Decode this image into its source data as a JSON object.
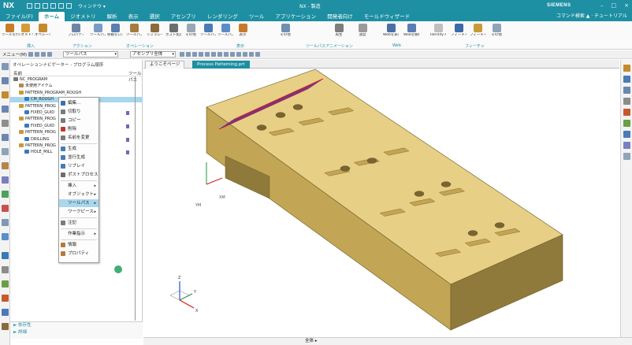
{
  "titlebar": {
    "logo": "NX",
    "window_menu": "ウィンドウ ▾",
    "document": "NX - 製造",
    "brand": "SIEMENS",
    "buttons": [
      "–",
      "□",
      "×"
    ]
  },
  "menubar": {
    "tabs": [
      "ファイル(F)",
      "ホーム",
      "ジオメトリ",
      "解析",
      "表示",
      "選択",
      "アセンブリ",
      "レンダリング",
      "ツール",
      "アプリケーション",
      "開発者向け",
      "モールドウィザード"
    ],
    "active_index": 1,
    "right_info": "コマンド検索    ▲ · チュートリアル"
  },
  "ribbon": {
    "buttons": [
      {
        "label": "ツールを作成",
        "color": "#c97c2a"
      },
      {
        "label": "ジオメトリを作成",
        "color": "#d59a3a"
      },
      {
        "label": "オペレーションを作成",
        "color": "#c48a2e"
      },
      {
        "label": "プロパティ",
        "color": "#6f85a8"
      },
      {
        "label": "ツールパス生成",
        "color": "#7a9cc4"
      },
      {
        "label": "移動をロック",
        "color": "#5a7fb0"
      },
      {
        "label": "ツールパスの検証",
        "color": "#a77a40"
      },
      {
        "label": "シミュレーション",
        "color": "#8a6b3c"
      },
      {
        "label": "ポスト処理",
        "color": "#6d6d6d"
      },
      {
        "label": "その他",
        "color": "#9aa6b5"
      },
      {
        "label": "ツールパスを表示",
        "color": "#4a7ab8"
      },
      {
        "label": "ツールパスを消去",
        "color": "#5c8cc6"
      },
      {
        "label": "表示",
        "color": "#c87a2c"
      },
      {
        "label": "その他",
        "color": "#6f8fb3"
      },
      {
        "label": "再生",
        "color": "#7d7d7d"
      },
      {
        "label": "速度",
        "color": "#9a9a9a"
      },
      {
        "label": "Webを表示",
        "color": "#4b6fa5"
      },
      {
        "label": "Webを解析",
        "color": "#5a7db3"
      },
      {
        "label": "Identify Features",
        "color": "#bfbfbf"
      },
      {
        "label": "フィーチャーを検出",
        "color": "#3b6aa8"
      },
      {
        "label": "フィーチャーグループ",
        "color": "#c99a3a"
      },
      {
        "label": "その他",
        "color": "#8fa3ba"
      }
    ],
    "groups": [
      "挿入",
      "アクション",
      "オペレーション",
      "表示",
      "ツールパスアニメーション",
      "Web",
      "フィーチャ"
    ]
  },
  "toolbar": {
    "menu_label": "メニュー(M) ▾",
    "filter_value": "ツールパス",
    "assembly_value": "アセンブリ全体"
  },
  "navigator": {
    "title": "オペレーションナビゲーター - プログラム順序",
    "col_name": "名前",
    "col_path": "ツールパス",
    "rows": [
      {
        "label": "NC_PROGRAM",
        "indent": 0,
        "icon": "#777777",
        "selected": false,
        "mark": false
      },
      {
        "label": "未使用アイテム",
        "indent": 1,
        "icon": "#b08a4a",
        "selected": false,
        "mark": false
      },
      {
        "label": "PATTERN_PROGRAM_ROUGH",
        "indent": 1,
        "icon": "#c89a3a",
        "selected": false,
        "mark": false
      },
      {
        "label": "CM_ROUGH",
        "indent": 2,
        "icon": "#3a7ab8",
        "selected": true,
        "mark": false
      },
      {
        "label": "PATTERN_PROG",
        "indent": 1,
        "icon": "#c89a3a",
        "selected": false,
        "mark": false
      },
      {
        "label": "FIXED_GUID",
        "indent": 2,
        "icon": "#3a7ab8",
        "selected": false,
        "mark": true
      },
      {
        "label": "PATTERN_PROG",
        "indent": 1,
        "icon": "#c89a3a",
        "selected": false,
        "mark": false
      },
      {
        "label": "FIXED_GUID",
        "indent": 2,
        "icon": "#3a7ab8",
        "selected": false,
        "mark": true
      },
      {
        "label": "PATTERN_PROG",
        "indent": 1,
        "icon": "#c89a3a",
        "selected": false,
        "mark": false
      },
      {
        "label": "DRILLING",
        "indent": 2,
        "icon": "#3a7ab8",
        "selected": false,
        "mark": true
      },
      {
        "label": "PATTERN_PROG",
        "indent": 1,
        "icon": "#c89a3a",
        "selected": false,
        "mark": false
      },
      {
        "label": "HOLE_MILL",
        "indent": 2,
        "icon": "#3a7ab8",
        "selected": false,
        "mark": true
      }
    ],
    "footer": [
      "► 依存性",
      "► 詳細"
    ]
  },
  "context_menu": {
    "items": [
      {
        "label": "編集...",
        "icon": "#3a6fb0",
        "submenu": false,
        "highlight": false,
        "sep_after": false
      },
      {
        "label": "切取り",
        "icon": "#7a7a7a",
        "submenu": false,
        "highlight": false,
        "sep_after": false
      },
      {
        "label": "コピー",
        "icon": "#7a7a7a",
        "submenu": false,
        "highlight": false,
        "sep_after": false
      },
      {
        "label": "削除",
        "icon": "#c0392b",
        "submenu": false,
        "highlight": false,
        "sep_after": false
      },
      {
        "label": "名前を変更",
        "icon": "#7a7a7a",
        "submenu": false,
        "highlight": false,
        "sep_after": true
      },
      {
        "label": "生成",
        "icon": "#4a7ab8",
        "submenu": false,
        "highlight": false,
        "sep_after": false
      },
      {
        "label": "並行生成",
        "icon": "#4a7ab8",
        "submenu": false,
        "highlight": false,
        "sep_after": false
      },
      {
        "label": "リプレイ",
        "icon": "#4a7ab8",
        "submenu": false,
        "highlight": false,
        "sep_after": false
      },
      {
        "label": "ポストプロセス",
        "icon": "#6d6d6d",
        "submenu": false,
        "highlight": false,
        "sep_after": true
      },
      {
        "label": "挿入",
        "icon": "",
        "submenu": true,
        "highlight": false,
        "sep_after": false
      },
      {
        "label": "オブジェクト",
        "icon": "",
        "submenu": true,
        "highlight": false,
        "sep_after": false
      },
      {
        "label": "ツールパス",
        "icon": "",
        "submenu": true,
        "highlight": true,
        "sep_after": false
      },
      {
        "label": "ワークピース",
        "icon": "",
        "submenu": true,
        "highlight": false,
        "sep_after": true
      },
      {
        "label": "注記",
        "icon": "#7a7a7a",
        "submenu": false,
        "highlight": false,
        "sep_after": true
      },
      {
        "label": "作業指示",
        "icon": "",
        "submenu": true,
        "highlight": false,
        "sep_after": true
      },
      {
        "label": "情報",
        "icon": "#b57a3a",
        "submenu": false,
        "highlight": false,
        "sep_after": false
      },
      {
        "label": "プロパティ",
        "icon": "#b57a3a",
        "submenu": false,
        "highlight": false,
        "sep_after": false
      }
    ]
  },
  "graphics": {
    "tabs": [
      "ようこそページ",
      "Process Patterning.prt"
    ],
    "active_tab": 1,
    "part_top_color": "#e7cf86",
    "part_side_color": "#c2a655",
    "part_dark_color": "#8f7a3c",
    "axis_x_label": "XM",
    "axis_y_label": "YM",
    "triad_labels": [
      "Z",
      "Y",
      "X"
    ]
  },
  "status": {
    "text": "全体 ▸"
  }
}
